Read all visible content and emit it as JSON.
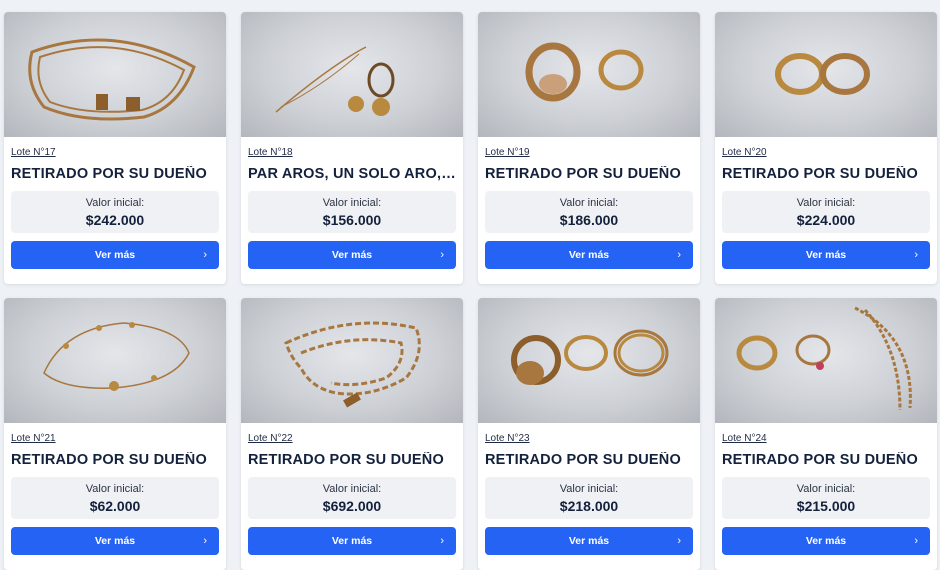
{
  "lots": [
    {
      "lote": "Lote N°17",
      "title": "RETIRADO POR SU DUEÑO",
      "price_label": "Valor inicial:",
      "price": "$242.000",
      "button": "Ver más",
      "image": "gold-chain-bracelet"
    },
    {
      "lote": "Lote N°18",
      "title": "PAR AROS, UN SOLO ARO, G...",
      "price_label": "Valor inicial:",
      "price": "$156.000",
      "button": "Ver más",
      "image": "earrings-and-chain"
    },
    {
      "lote": "Lote N°19",
      "title": "RETIRADO POR SU DUEÑO",
      "price_label": "Valor inicial:",
      "price": "$186.000",
      "button": "Ver más",
      "image": "two-rings"
    },
    {
      "lote": "Lote N°20",
      "title": "RETIRADO POR SU DUEÑO",
      "price_label": "Valor inicial:",
      "price": "$224.000",
      "button": "Ver más",
      "image": "two-wedding-bands"
    },
    {
      "lote": "Lote N°21",
      "title": "RETIRADO POR SU DUEÑO",
      "price_label": "Valor inicial:",
      "price": "$62.000",
      "button": "Ver más",
      "image": "beaded-bracelet"
    },
    {
      "lote": "Lote N°22",
      "title": "RETIRADO POR SU DUEÑO",
      "price_label": "Valor inicial:",
      "price": "$692.000",
      "button": "Ver más",
      "image": "figaro-chain"
    },
    {
      "lote": "Lote N°23",
      "title": "RETIRADO POR SU DUEÑO",
      "price_label": "Valor inicial:",
      "price": "$218.000",
      "button": "Ver más",
      "image": "three-rings"
    },
    {
      "lote": "Lote N°24",
      "title": "RETIRADO POR SU DUEÑO",
      "price_label": "Valor inicial:",
      "price": "$215.000",
      "button": "Ver más",
      "image": "rings-and-chain"
    }
  ],
  "colors": {
    "accent": "#2563f5",
    "title": "#14213d",
    "card": "#ffffff",
    "page": "#eef1f6",
    "gold": "#b98a4e"
  },
  "icons": {
    "button_chevron": "chevron-right-icon"
  }
}
